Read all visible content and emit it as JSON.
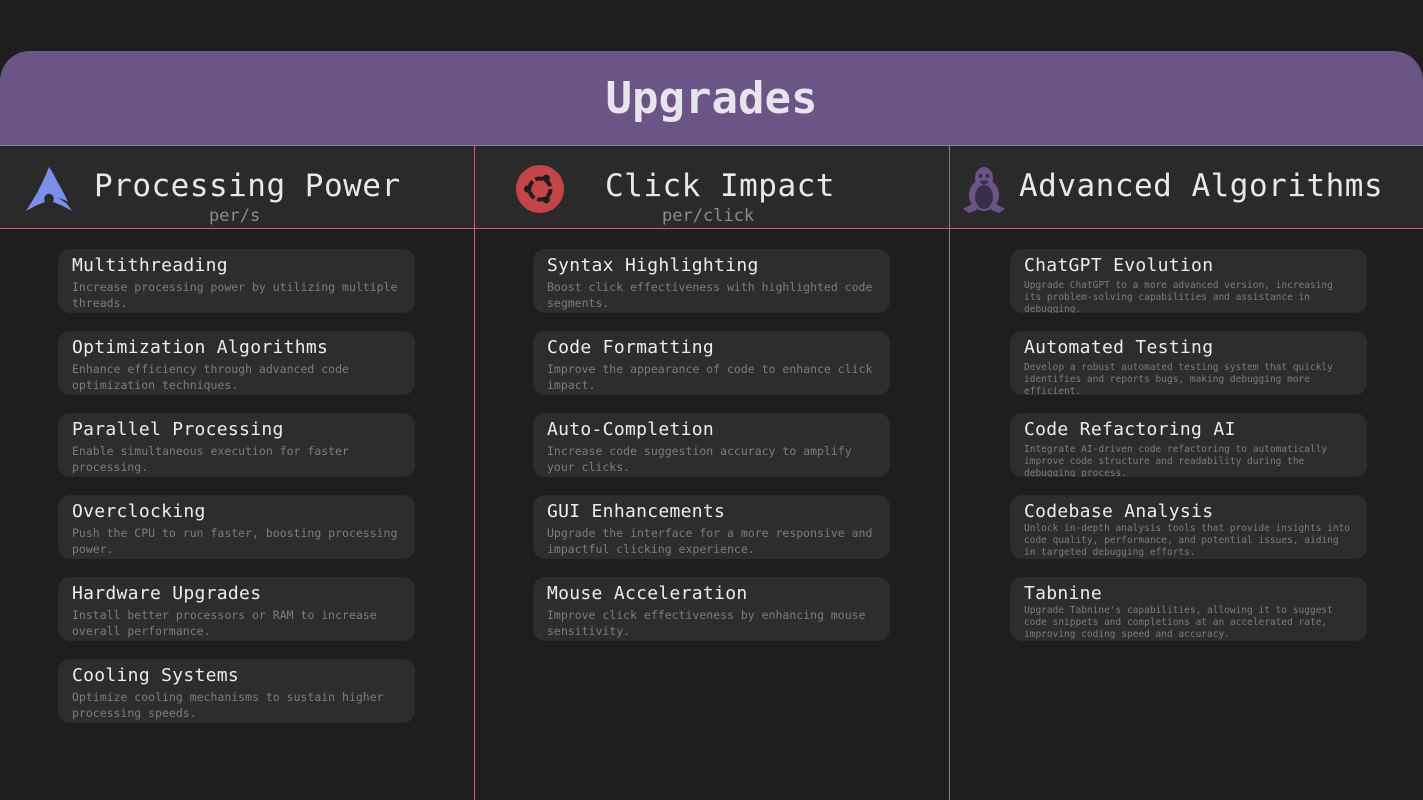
{
  "header": {
    "title": "Upgrades"
  },
  "columns": [
    {
      "title": "Processing Power",
      "subtitle": "per/s",
      "icon": "arch-linux-icon",
      "icon_color": "#7b8fe8",
      "cards": [
        {
          "title": "Multithreading",
          "desc": "Increase processing power by utilizing multiple threads."
        },
        {
          "title": "Optimization Algorithms",
          "desc": "Enhance efficiency through advanced code optimization techniques."
        },
        {
          "title": "Parallel Processing",
          "desc": "Enable simultaneous execution for faster processing."
        },
        {
          "title": "Overclocking",
          "desc": "Push the CPU to run faster, boosting processing power."
        },
        {
          "title": "Hardware Upgrades",
          "desc": "Install better processors or RAM to increase overall performance."
        },
        {
          "title": "Cooling Systems",
          "desc": "Optimize cooling mechanisms to sustain higher processing speeds."
        }
      ]
    },
    {
      "title": "Click Impact",
      "subtitle": "per/click",
      "icon": "ubuntu-icon",
      "icon_color": "#c44545",
      "cards": [
        {
          "title": "Syntax Highlighting",
          "desc": "Boost click effectiveness with highlighted code segments."
        },
        {
          "title": "Code Formatting",
          "desc": "Improve the appearance of code to enhance click impact."
        },
        {
          "title": "Auto-Completion",
          "desc": "Increase code suggestion accuracy to amplify your clicks."
        },
        {
          "title": "GUI Enhancements",
          "desc": "Upgrade the interface for a more responsive and impactful clicking experience."
        },
        {
          "title": "Mouse Acceleration",
          "desc": "Improve click effectiveness by enhancing mouse sensitivity."
        }
      ]
    },
    {
      "title": "Advanced Algorithms",
      "subtitle": "",
      "icon": "linux-tux-icon",
      "icon_color": "#6a5586",
      "cards": [
        {
          "title": "ChatGPT Evolution",
          "desc": "Upgrade ChatGPT to a more advanced version, increasing its problem-solving capabilities and assistance in debugging."
        },
        {
          "title": "Automated Testing",
          "desc": "Develop a robust automated testing system that quickly identifies and reports bugs, making debugging more efficient."
        },
        {
          "title": "Code Refactoring AI",
          "desc": "Integrate AI-driven code refactoring to automatically improve code structure and readability during the debugging process."
        },
        {
          "title": "Codebase Analysis",
          "desc": "Unlock in-depth analysis tools that provide insights into code quality, performance, and potential issues, aiding in targeted debugging efforts."
        },
        {
          "title": "Tabnine",
          "desc": "Upgrade Tabnine's capabilities, allowing it to suggest code snippets and completions at an accelerated rate, improving coding speed and accuracy."
        }
      ]
    }
  ]
}
